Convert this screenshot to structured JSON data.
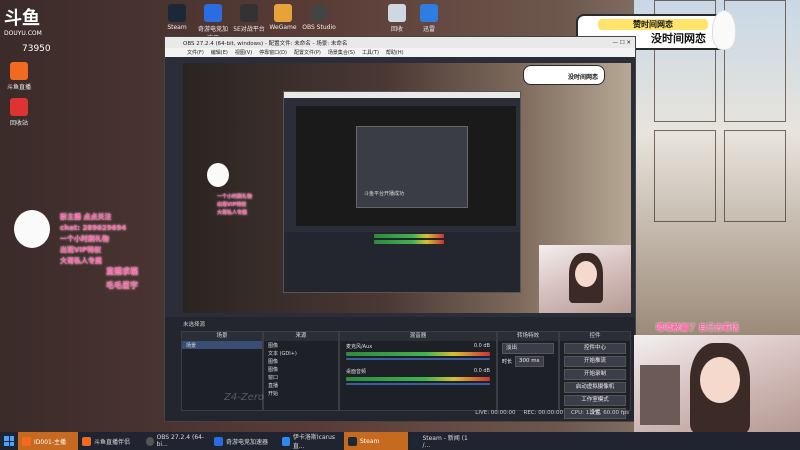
{
  "desktop": {
    "logo": {
      "main": "斗鱼",
      "sub": "DOUYU.COM"
    },
    "room_number": "73950",
    "icons": [
      {
        "label": "Steam"
      },
      {
        "label": "奇游电竞加速器"
      },
      {
        "label": "5E对战平台"
      },
      {
        "label": "WeGame"
      },
      {
        "label": "OBS Studio"
      },
      {
        "label": "回收"
      },
      {
        "label": "迅雷"
      }
    ],
    "left_icons": [
      {
        "label": "斗鱼直播"
      },
      {
        "label": "回收站"
      }
    ]
  },
  "overlay": {
    "banner_top": "赞时间网恋",
    "banner_main": "没时间网恋",
    "left_chat": [
      "新主播 点点关注",
      "chat: 289029694",
      "一个小时刷礼物",
      "出现VIP特权",
      "大哥私人专属"
    ],
    "left_tag": "直播求福",
    "left_tag2": "毛毛星宇",
    "right_text": "嘻嘻被骗了 自己去看话",
    "watermark": "Z4-Zero"
  },
  "obs": {
    "title": "OBS 27.2.4 (64-bit, windows) - 配置文件: 未命名 - 场景: 未命名",
    "menu": [
      "文件(F)",
      "编辑(E)",
      "视图(V)",
      "停靠窗口(D)",
      "配置文件(P)",
      "场景集合(S)",
      "工具(T)",
      "帮助(H)"
    ],
    "preview_label": "斗鱼平台开播成功",
    "scenes_header": "场景",
    "scenes": [
      "场景"
    ],
    "sources_header": "来源",
    "sources": [
      "图像",
      "文本 (GDI+)",
      "图像",
      "图像",
      "窗口",
      "直播",
      "开始"
    ],
    "mixer_header": "混音器",
    "mixer": [
      {
        "name": "麦克风/Aux",
        "db": "0.0 dB"
      },
      {
        "name": "桌面音频",
        "db": "0.0 dB"
      }
    ],
    "transitions_header": "转场特效",
    "transition_value": "淡出",
    "duration_label": "时长",
    "duration_value": "300 ms",
    "controls_header": "控件",
    "controls": [
      "控件中心",
      "开始推流",
      "开始录制",
      "启动虚拟摄像机",
      "工作室模式",
      "设置",
      "退出"
    ],
    "status": [
      "LIVE: 00:00:00",
      "REC: 00:00:00",
      "CPU: 1.5%, 60.00 fps"
    ],
    "no_source": "未选择源"
  },
  "taskbar": {
    "items": [
      {
        "label": "ID001-主播",
        "active": true
      },
      {
        "label": "斗鱼直播伴侣",
        "active": false
      },
      {
        "label": "OBS 27.2.4 (64-bi...",
        "active": false
      },
      {
        "label": "奇游电竞加速器",
        "active": false
      },
      {
        "label": "伊卡洛斯Icarus直...",
        "active": false
      },
      {
        "label": "Steam",
        "active": true
      },
      {
        "label": "Steam - 新闻 (1 /...",
        "active": false
      }
    ]
  },
  "colors": {
    "accent": "#c56a1e",
    "pink": "#ff5fa6",
    "obs_bg": "#2b2e38"
  }
}
